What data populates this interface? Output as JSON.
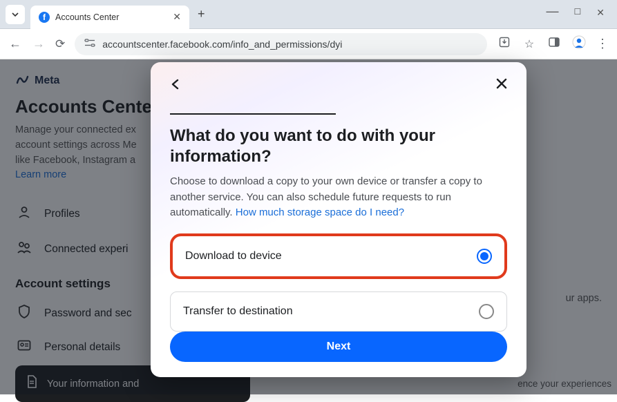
{
  "browser": {
    "tab_title": "Accounts Center",
    "url": "accountscenter.facebook.com/info_and_permissions/dyi"
  },
  "page": {
    "brand": "Meta",
    "title": "Accounts Center",
    "description_line1": "Manage your connected ex",
    "description_line2": "account settings across Me",
    "description_line3": "like Facebook, Instagram a",
    "learn_more": "Learn more",
    "sidebar": {
      "profiles": "Profiles",
      "connected": "Connected experi"
    },
    "section_title": "Account settings",
    "items": {
      "password": "Password and sec",
      "personal": "Personal details",
      "your_info": "Your information and"
    },
    "right_fragment": "ur apps.",
    "right_fragment2": "ence your experiences"
  },
  "modal": {
    "heading": "What do you want to do with your information?",
    "description": "Choose to download a copy to your own device or transfer a copy to another service. You can also schedule future requests to run automatically. ",
    "storage_link": "How much storage space do I need?",
    "option_download": "Download to device",
    "option_transfer": "Transfer to destination",
    "next": "Next"
  }
}
